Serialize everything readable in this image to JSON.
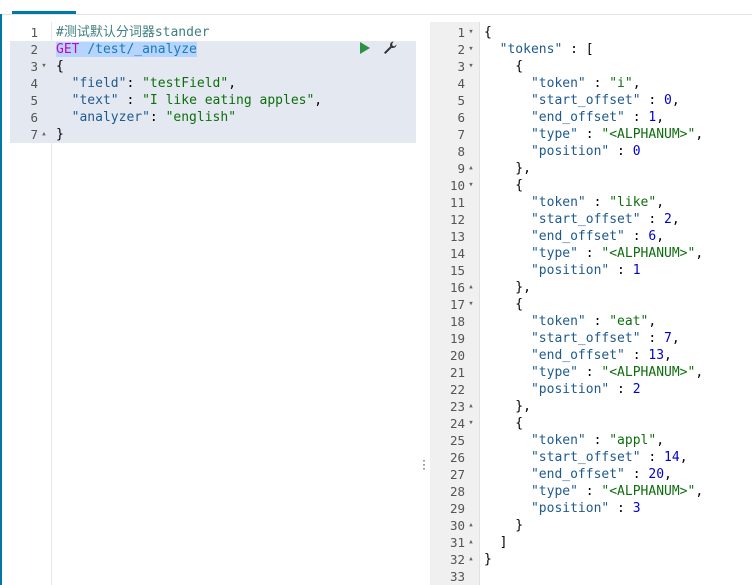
{
  "request": {
    "lines": [
      {
        "n": "1",
        "fold": "",
        "parts": [
          {
            "t": "#测试默认分词器stander",
            "c": "c-comment"
          }
        ]
      },
      {
        "n": "2",
        "fold": "",
        "parts": [
          {
            "t": "GET",
            "c": "c-method c-sel"
          },
          {
            "t": " ",
            "c": "c-sel"
          },
          {
            "t": "/test/_analyze",
            "c": "c-url c-sel"
          }
        ]
      },
      {
        "n": "3",
        "fold": "▾",
        "parts": [
          {
            "t": "{",
            "c": "c-punc"
          }
        ]
      },
      {
        "n": "4",
        "fold": "",
        "parts": [
          {
            "t": "  \"field\"",
            "c": "c-key"
          },
          {
            "t": ": ",
            "c": "c-punc"
          },
          {
            "t": "\"testField\"",
            "c": "c-str"
          },
          {
            "t": ",",
            "c": "c-punc"
          }
        ]
      },
      {
        "n": "5",
        "fold": "",
        "parts": [
          {
            "t": "  \"text\"",
            "c": "c-key"
          },
          {
            "t": " : ",
            "c": "c-punc"
          },
          {
            "t": "\"I like eating apples\"",
            "c": "c-str"
          },
          {
            "t": ",",
            "c": "c-punc"
          }
        ]
      },
      {
        "n": "6",
        "fold": "",
        "parts": [
          {
            "t": "  \"analyzer\"",
            "c": "c-key"
          },
          {
            "t": ": ",
            "c": "c-punc"
          },
          {
            "t": "\"english\"",
            "c": "c-str"
          }
        ]
      },
      {
        "n": "7",
        "fold": "▴",
        "parts": [
          {
            "t": "}",
            "c": "c-punc"
          }
        ]
      }
    ]
  },
  "response": {
    "lines": [
      {
        "n": "1",
        "fold": "▾",
        "parts": [
          {
            "t": "{",
            "c": "c-punc"
          }
        ]
      },
      {
        "n": "2",
        "fold": "▾",
        "parts": [
          {
            "t": "  \"tokens\"",
            "c": "c-key"
          },
          {
            "t": " : [",
            "c": "c-punc"
          }
        ]
      },
      {
        "n": "3",
        "fold": "▾",
        "parts": [
          {
            "t": "    {",
            "c": "c-punc"
          }
        ]
      },
      {
        "n": "4",
        "fold": "",
        "parts": [
          {
            "t": "      \"token\"",
            "c": "c-key"
          },
          {
            "t": " : ",
            "c": "c-punc"
          },
          {
            "t": "\"i\"",
            "c": "c-str"
          },
          {
            "t": ",",
            "c": "c-punc"
          }
        ]
      },
      {
        "n": "5",
        "fold": "",
        "parts": [
          {
            "t": "      \"start_offset\"",
            "c": "c-key"
          },
          {
            "t": " : ",
            "c": "c-punc"
          },
          {
            "t": "0",
            "c": "c-num"
          },
          {
            "t": ",",
            "c": "c-punc"
          }
        ]
      },
      {
        "n": "6",
        "fold": "",
        "parts": [
          {
            "t": "      \"end_offset\"",
            "c": "c-key"
          },
          {
            "t": " : ",
            "c": "c-punc"
          },
          {
            "t": "1",
            "c": "c-num"
          },
          {
            "t": ",",
            "c": "c-punc"
          }
        ]
      },
      {
        "n": "7",
        "fold": "",
        "parts": [
          {
            "t": "      \"type\"",
            "c": "c-key"
          },
          {
            "t": " : ",
            "c": "c-punc"
          },
          {
            "t": "\"<ALPHANUM>\"",
            "c": "c-str"
          },
          {
            "t": ",",
            "c": "c-punc"
          }
        ]
      },
      {
        "n": "8",
        "fold": "",
        "parts": [
          {
            "t": "      \"position\"",
            "c": "c-key"
          },
          {
            "t": " : ",
            "c": "c-punc"
          },
          {
            "t": "0",
            "c": "c-num"
          }
        ]
      },
      {
        "n": "9",
        "fold": "▴",
        "parts": [
          {
            "t": "    },",
            "c": "c-punc"
          }
        ]
      },
      {
        "n": "10",
        "fold": "▾",
        "parts": [
          {
            "t": "    {",
            "c": "c-punc"
          }
        ]
      },
      {
        "n": "11",
        "fold": "",
        "parts": [
          {
            "t": "      \"token\"",
            "c": "c-key"
          },
          {
            "t": " : ",
            "c": "c-punc"
          },
          {
            "t": "\"like\"",
            "c": "c-str"
          },
          {
            "t": ",",
            "c": "c-punc"
          }
        ]
      },
      {
        "n": "12",
        "fold": "",
        "parts": [
          {
            "t": "      \"start_offset\"",
            "c": "c-key"
          },
          {
            "t": " : ",
            "c": "c-punc"
          },
          {
            "t": "2",
            "c": "c-num"
          },
          {
            "t": ",",
            "c": "c-punc"
          }
        ]
      },
      {
        "n": "13",
        "fold": "",
        "parts": [
          {
            "t": "      \"end_offset\"",
            "c": "c-key"
          },
          {
            "t": " : ",
            "c": "c-punc"
          },
          {
            "t": "6",
            "c": "c-num"
          },
          {
            "t": ",",
            "c": "c-punc"
          }
        ]
      },
      {
        "n": "14",
        "fold": "",
        "parts": [
          {
            "t": "      \"type\"",
            "c": "c-key"
          },
          {
            "t": " : ",
            "c": "c-punc"
          },
          {
            "t": "\"<ALPHANUM>\"",
            "c": "c-str"
          },
          {
            "t": ",",
            "c": "c-punc"
          }
        ]
      },
      {
        "n": "15",
        "fold": "",
        "parts": [
          {
            "t": "      \"position\"",
            "c": "c-key"
          },
          {
            "t": " : ",
            "c": "c-punc"
          },
          {
            "t": "1",
            "c": "c-num"
          }
        ]
      },
      {
        "n": "16",
        "fold": "▴",
        "parts": [
          {
            "t": "    },",
            "c": "c-punc"
          }
        ]
      },
      {
        "n": "17",
        "fold": "▾",
        "parts": [
          {
            "t": "    {",
            "c": "c-punc"
          }
        ]
      },
      {
        "n": "18",
        "fold": "",
        "parts": [
          {
            "t": "      \"token\"",
            "c": "c-key"
          },
          {
            "t": " : ",
            "c": "c-punc"
          },
          {
            "t": "\"eat\"",
            "c": "c-str"
          },
          {
            "t": ",",
            "c": "c-punc"
          }
        ]
      },
      {
        "n": "19",
        "fold": "",
        "parts": [
          {
            "t": "      \"start_offset\"",
            "c": "c-key"
          },
          {
            "t": " : ",
            "c": "c-punc"
          },
          {
            "t": "7",
            "c": "c-num"
          },
          {
            "t": ",",
            "c": "c-punc"
          }
        ]
      },
      {
        "n": "20",
        "fold": "",
        "parts": [
          {
            "t": "      \"end_offset\"",
            "c": "c-key"
          },
          {
            "t": " : ",
            "c": "c-punc"
          },
          {
            "t": "13",
            "c": "c-num"
          },
          {
            "t": ",",
            "c": "c-punc"
          }
        ]
      },
      {
        "n": "21",
        "fold": "",
        "parts": [
          {
            "t": "      \"type\"",
            "c": "c-key"
          },
          {
            "t": " : ",
            "c": "c-punc"
          },
          {
            "t": "\"<ALPHANUM>\"",
            "c": "c-str"
          },
          {
            "t": ",",
            "c": "c-punc"
          }
        ]
      },
      {
        "n": "22",
        "fold": "",
        "parts": [
          {
            "t": "      \"position\"",
            "c": "c-key"
          },
          {
            "t": " : ",
            "c": "c-punc"
          },
          {
            "t": "2",
            "c": "c-num"
          }
        ]
      },
      {
        "n": "23",
        "fold": "▴",
        "parts": [
          {
            "t": "    },",
            "c": "c-punc"
          }
        ]
      },
      {
        "n": "24",
        "fold": "▾",
        "parts": [
          {
            "t": "    {",
            "c": "c-punc"
          }
        ]
      },
      {
        "n": "25",
        "fold": "",
        "parts": [
          {
            "t": "      \"token\"",
            "c": "c-key"
          },
          {
            "t": " : ",
            "c": "c-punc"
          },
          {
            "t": "\"appl\"",
            "c": "c-str"
          },
          {
            "t": ",",
            "c": "c-punc"
          }
        ]
      },
      {
        "n": "26",
        "fold": "",
        "parts": [
          {
            "t": "      \"start_offset\"",
            "c": "c-key"
          },
          {
            "t": " : ",
            "c": "c-punc"
          },
          {
            "t": "14",
            "c": "c-num"
          },
          {
            "t": ",",
            "c": "c-punc"
          }
        ]
      },
      {
        "n": "27",
        "fold": "",
        "parts": [
          {
            "t": "      \"end_offset\"",
            "c": "c-key"
          },
          {
            "t": " : ",
            "c": "c-punc"
          },
          {
            "t": "20",
            "c": "c-num"
          },
          {
            "t": ",",
            "c": "c-punc"
          }
        ]
      },
      {
        "n": "28",
        "fold": "",
        "parts": [
          {
            "t": "      \"type\"",
            "c": "c-key"
          },
          {
            "t": " : ",
            "c": "c-punc"
          },
          {
            "t": "\"<ALPHANUM>\"",
            "c": "c-str"
          },
          {
            "t": ",",
            "c": "c-punc"
          }
        ]
      },
      {
        "n": "29",
        "fold": "",
        "parts": [
          {
            "t": "      \"position\"",
            "c": "c-key"
          },
          {
            "t": " : ",
            "c": "c-punc"
          },
          {
            "t": "3",
            "c": "c-num"
          }
        ]
      },
      {
        "n": "30",
        "fold": "▴",
        "parts": [
          {
            "t": "    }",
            "c": "c-punc"
          }
        ]
      },
      {
        "n": "31",
        "fold": "▴",
        "parts": [
          {
            "t": "  ]",
            "c": "c-punc"
          }
        ]
      },
      {
        "n": "32",
        "fold": "▴",
        "parts": [
          {
            "t": "}",
            "c": "c-punc"
          }
        ]
      },
      {
        "n": "33",
        "fold": "",
        "parts": []
      }
    ]
  },
  "toolbar": {
    "run_icon": "play-icon",
    "settings_icon": "wrench-icon"
  },
  "colors": {
    "accent": "#0079a5",
    "run_green": "#2c8f4a",
    "highlight_bg": "#e4e8f0"
  }
}
